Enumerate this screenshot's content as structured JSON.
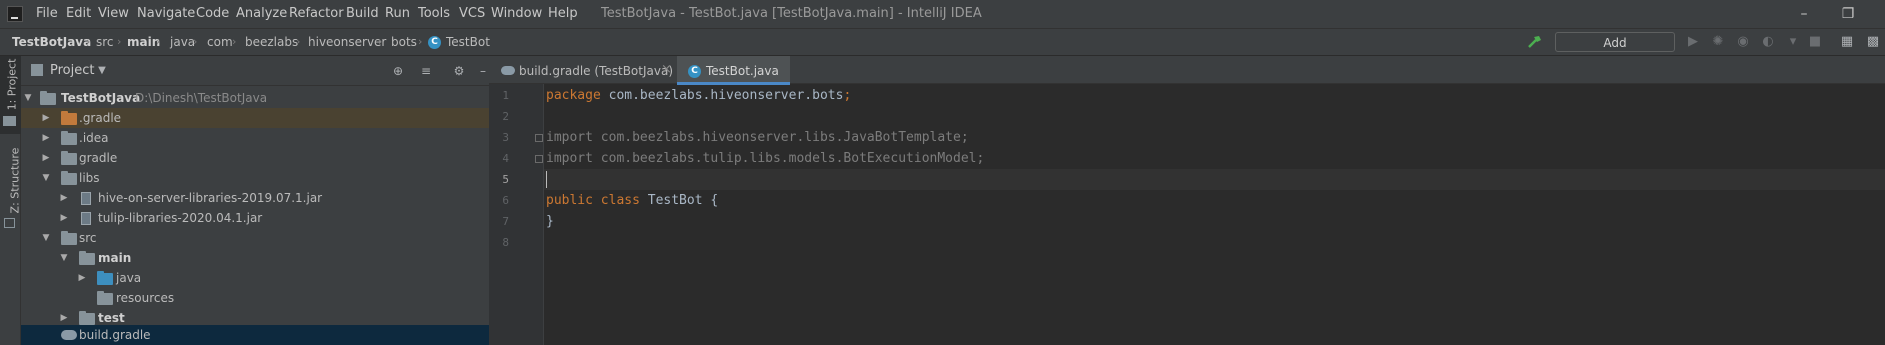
{
  "menu": [
    "File",
    "Edit",
    "View",
    "Navigate",
    "Code",
    "Analyze",
    "Refactor",
    "Build",
    "Run",
    "Tools",
    "VCS",
    "Window",
    "Help"
  ],
  "window_title": "TestBotJava - TestBot.java [TestBotJava.main] - IntelliJ IDEA",
  "window_buttons": {
    "minimize": "–",
    "restore": "❐"
  },
  "breadcrumb": [
    "TestBotJava",
    "src",
    "main",
    "java",
    "com",
    "beezlabs",
    "hiveonserver",
    "bots",
    "TestBot"
  ],
  "breadcrumb_sep": "›",
  "toolbar": {
    "add_config": "Add Configuration..."
  },
  "left_strip": {
    "project_tab": "1: Project",
    "structure_tab": "Z: Structure"
  },
  "project_panel": {
    "title": "Project",
    "tree": [
      {
        "label": "TestBotJava",
        "suffix": "D:\\Dinesh\\TestBotJava"
      },
      {
        "label": ".gradle"
      },
      {
        "label": ".idea"
      },
      {
        "label": "gradle"
      },
      {
        "label": "libs"
      },
      {
        "label": "hive-on-server-libraries-2019.07.1.jar"
      },
      {
        "label": "tulip-libraries-2020.04.1.jar"
      },
      {
        "label": "src"
      },
      {
        "label": "main"
      },
      {
        "label": "java"
      },
      {
        "label": "resources"
      },
      {
        "label": "test"
      },
      {
        "label": "build.gradle"
      }
    ]
  },
  "editor": {
    "tabs": [
      {
        "label": "build.gradle (TestBotJava)",
        "active": false
      },
      {
        "label": "TestBot.java",
        "active": true
      }
    ],
    "lines": [
      {
        "n": "1",
        "kw": "package",
        "rest": " com.beezlabs.hiveonserver.bots",
        "end": ";"
      },
      {
        "n": "2",
        "kw": "",
        "rest": "",
        "end": ""
      },
      {
        "n": "3",
        "kw": "import",
        "rest": " com.beezlabs.hiveonserver.libs.JavaBotTemplate",
        "end": ";"
      },
      {
        "n": "4",
        "kw": "import",
        "rest": " com.beezlabs.tulip.libs.models.BotExecutionModel",
        "end": ";"
      },
      {
        "n": "5",
        "kw": "",
        "rest": "",
        "end": ""
      },
      {
        "n": "6",
        "kw": "public class",
        "rest": " TestBot ",
        "end": "{"
      },
      {
        "n": "7",
        "kw": "",
        "rest": "}",
        "end": ""
      },
      {
        "n": "8",
        "kw": "",
        "rest": "",
        "end": ""
      }
    ],
    "close_glyph": "×"
  },
  "colors": {
    "accent": "#4a88c7",
    "keyword": "#cc7832",
    "text": "#a9b7c6",
    "build_hammer": "#4caf50"
  }
}
